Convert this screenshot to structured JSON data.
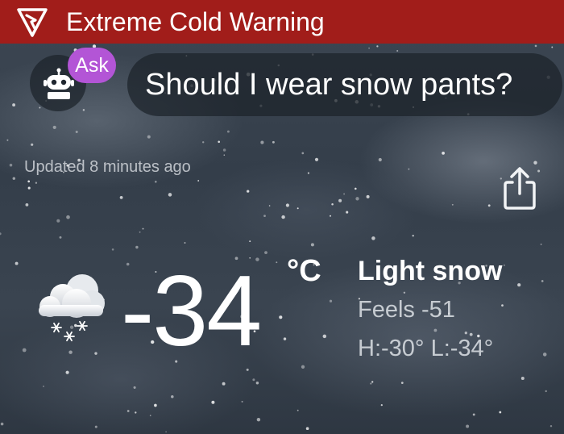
{
  "alert": {
    "title": "Extreme Cold Warning",
    "color": "#a11d1a"
  },
  "assistant": {
    "badge_label": "Ask",
    "badge_color": "#b355d6",
    "question": "Should I wear snow pants?",
    "icon": "robot-icon"
  },
  "status": {
    "updated": "Updated 8 minutes ago",
    "share_icon": "share-icon"
  },
  "current": {
    "icon": "snow-cloud-icon",
    "temperature": "-34",
    "unit": "°C",
    "condition": "Light snow",
    "feels_like": "Feels -51",
    "high_low": "H:-30° L:-34°"
  }
}
